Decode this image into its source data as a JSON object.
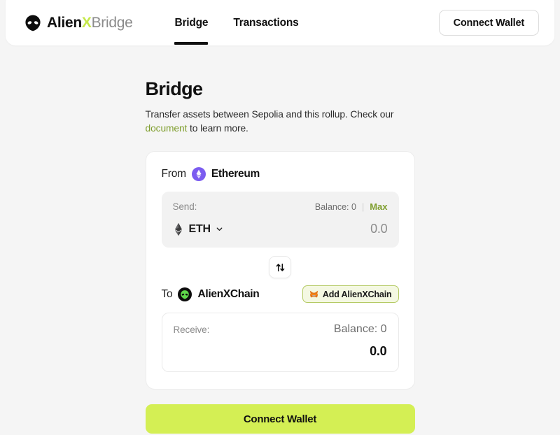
{
  "header": {
    "brand": {
      "alien": "Alien",
      "x": "X",
      "bridge": "Bridge"
    },
    "nav": [
      {
        "label": "Bridge",
        "active": true
      },
      {
        "label": "Transactions",
        "active": false
      }
    ],
    "connect_wallet_label": "Connect Wallet"
  },
  "main": {
    "title": "Bridge",
    "description_before": "Transfer assets between Sepolia and this rollup. Check our ",
    "description_link": "document",
    "description_after": " to learn more.",
    "from": {
      "label": "From",
      "chain": "Ethereum",
      "send_label": "Send:",
      "balance": "Balance: 0",
      "divider": "|",
      "max_label": "Max",
      "token": "ETH",
      "amount": "0.0"
    },
    "to": {
      "label": "To",
      "chain": "AlienXChain",
      "add_chain_label": "Add AlienXChain",
      "receive_label": "Receive:",
      "balance": "Balance: 0",
      "amount": "0.0"
    },
    "submit_label": "Connect Wallet"
  },
  "colors": {
    "accent_lime": "#d4ef54",
    "brand_x": "#c6e84c",
    "link_olive": "#7f9e2e",
    "ethereum_purple": "#7b5cf0",
    "metamask_orange": "#e2761b",
    "page_bg": "#f5f5f5"
  }
}
